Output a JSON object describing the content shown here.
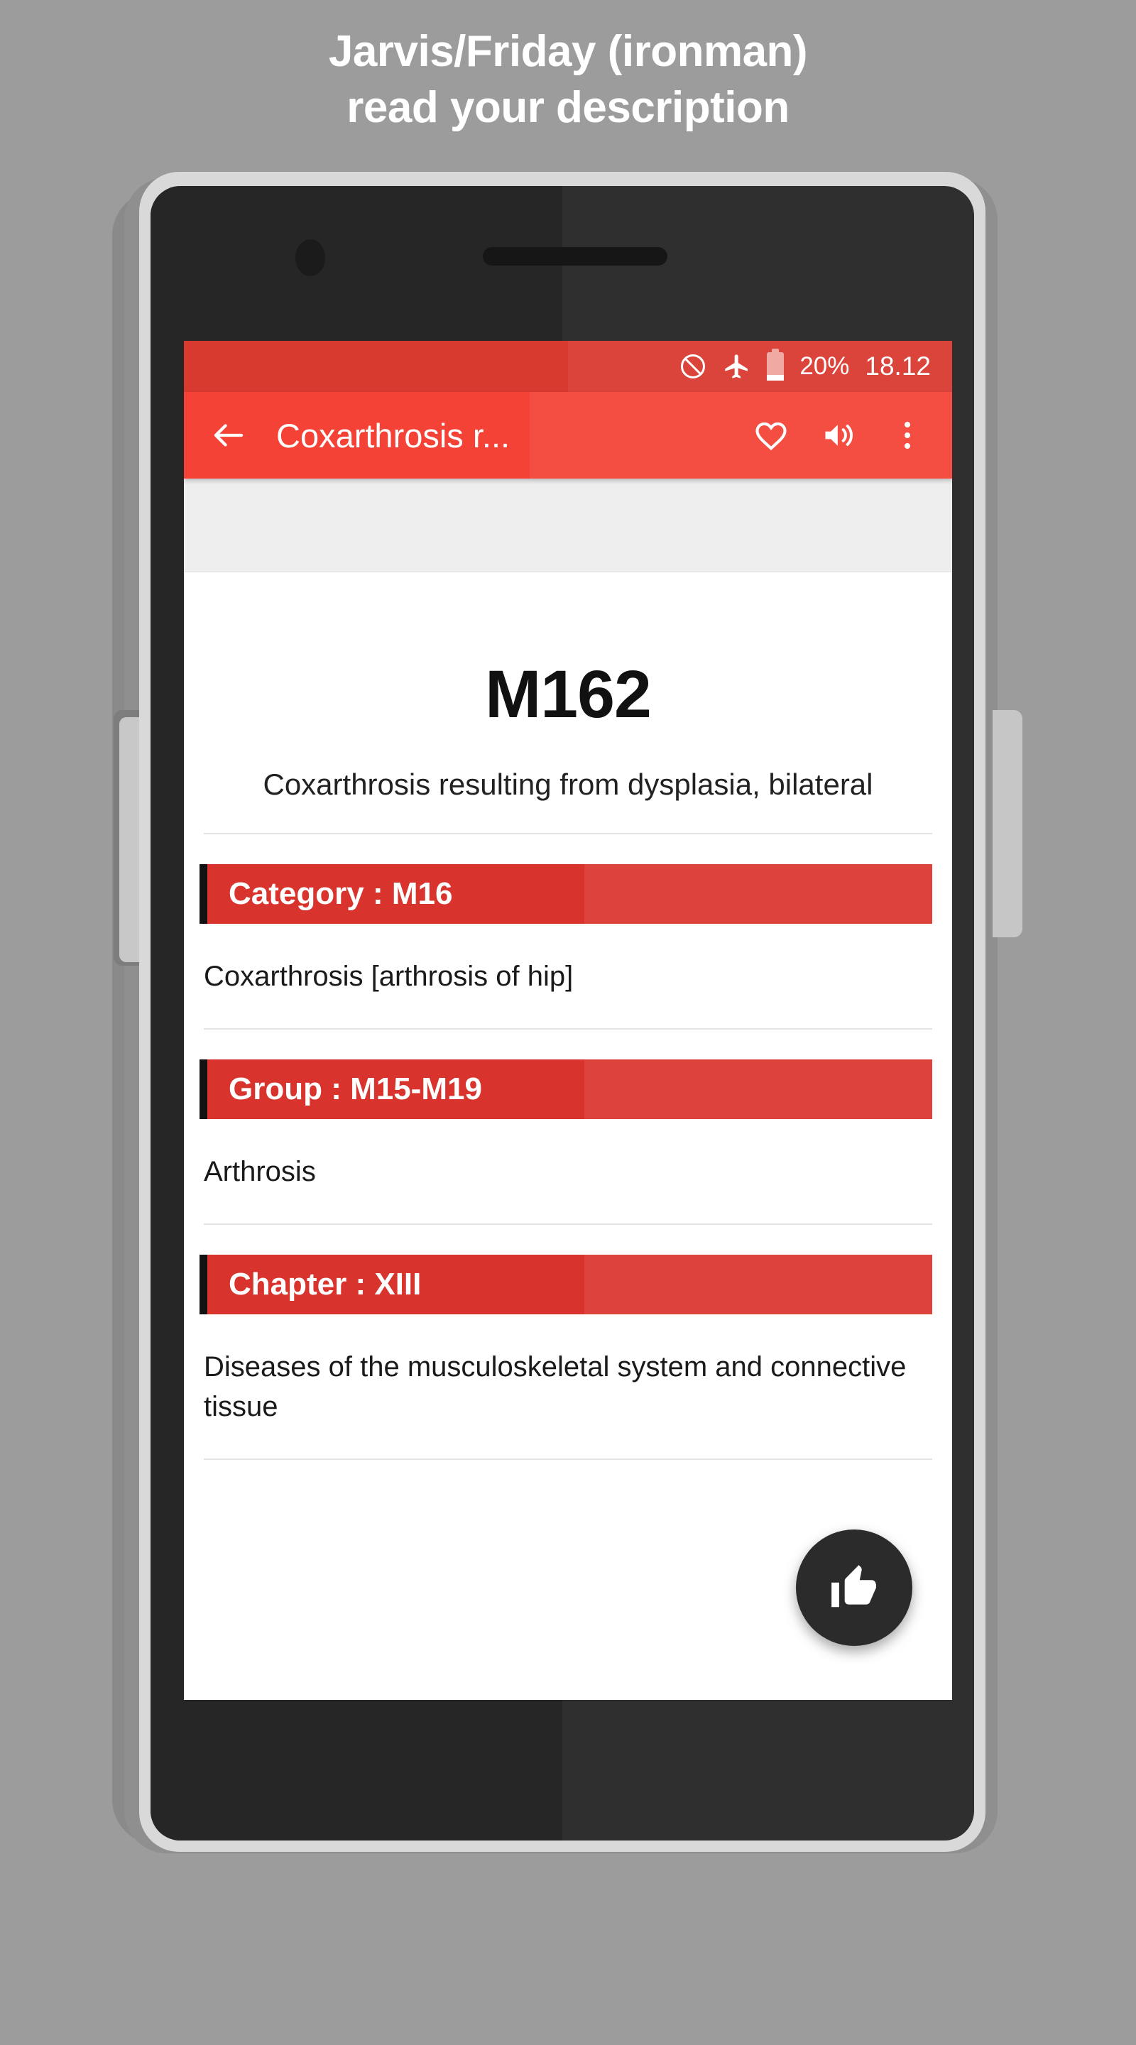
{
  "promo": {
    "line1": "Jarvis/Friday (ironman)",
    "line2": "read your description"
  },
  "device": {
    "camera_icon": "camera-dot",
    "speaker_icon": "earpiece-speaker"
  },
  "status_bar": {
    "do_not_disturb_icon": "do-not-disturb-icon",
    "airplane_icon": "airplane-mode-icon",
    "battery_icon": "battery-low-icon",
    "battery_level": "20%",
    "time": "18.12"
  },
  "app_bar": {
    "back_icon": "back-arrow-icon",
    "title": "Coxarthrosis r...",
    "favorite_icon": "heart-outline-icon",
    "sound_icon": "volume-speaker-icon",
    "overflow_icon": "overflow-menu-icon",
    "accent_color": "#f44336"
  },
  "ad_band": {
    "placeholder": ""
  },
  "detail": {
    "code": "M162",
    "description": "Coxarthrosis resulting from dysplasia, bilateral",
    "sections": [
      {
        "header": "Category : M16",
        "body": "Coxarthrosis [arthrosis of hip]"
      },
      {
        "header": "Group : M15-M19",
        "body": "Arthrosis"
      },
      {
        "header": "Chapter : XIII",
        "body": "Diseases of the musculoskeletal system and connective tissue"
      }
    ],
    "section_color": "#d8332c",
    "section_edge_color": "#121212"
  },
  "fab": {
    "icon": "thumbs-up-icon",
    "background_color": "#2b2b2b"
  }
}
